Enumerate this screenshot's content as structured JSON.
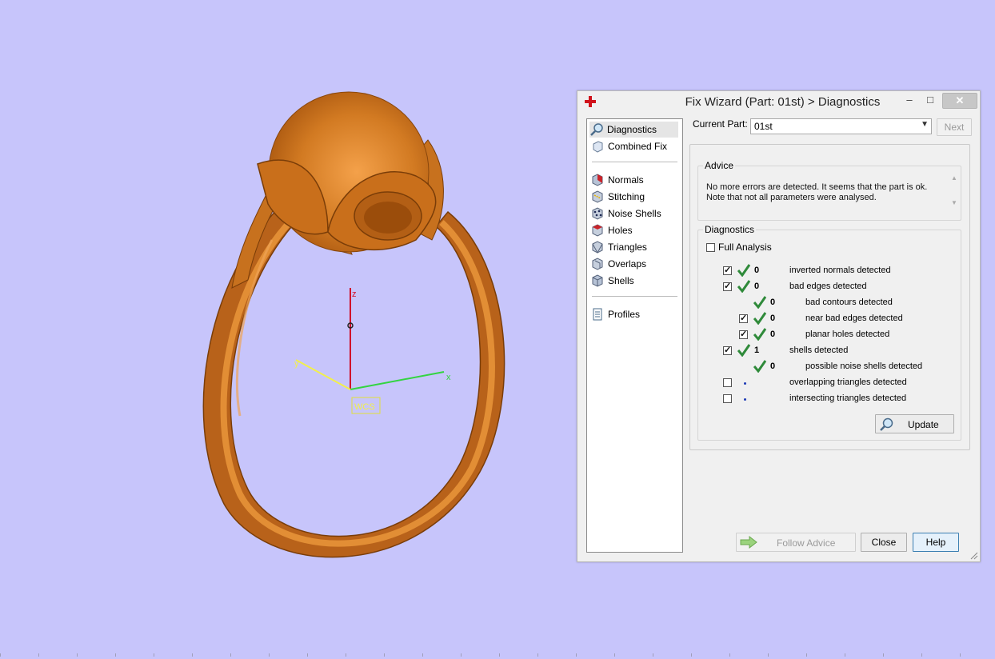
{
  "scene": {
    "axes": {
      "z_label": "z",
      "y_label": "y",
      "x_label": "x",
      "wcs_label": "WCS"
    },
    "colors": {
      "background": "#c7c5fb",
      "ring": "#c7711e",
      "z_axis": "#d0102a",
      "y_axis": "#f2f04a",
      "x_axis": "#33d441"
    }
  },
  "dialog": {
    "title": "Fix Wizard (Part: 01st) > Diagnostics",
    "window_buttons": {
      "minimize": "–",
      "maximize": "□",
      "close": "✕"
    },
    "nav": {
      "items_top": [
        {
          "label": "Diagnostics",
          "icon": "magnifier-icon",
          "selected": true
        },
        {
          "label": "Combined Fix",
          "icon": "combined-fix-icon",
          "selected": false
        }
      ],
      "items_mid": [
        {
          "label": "Normals",
          "icon": "normals-icon"
        },
        {
          "label": "Stitching",
          "icon": "stitching-icon"
        },
        {
          "label": "Noise Shells",
          "icon": "noise-shells-icon"
        },
        {
          "label": "Holes",
          "icon": "holes-icon"
        },
        {
          "label": "Triangles",
          "icon": "triangles-icon"
        },
        {
          "label": "Overlaps",
          "icon": "overlaps-icon"
        },
        {
          "label": "Shells",
          "icon": "shells-icon"
        }
      ],
      "items_bottom": [
        {
          "label": "Profiles",
          "icon": "profiles-icon"
        }
      ]
    },
    "current_part_label": "Current Part:",
    "current_part_value": "01st",
    "next_label": "Next",
    "advice": {
      "legend": "Advice",
      "line1": "No more errors are detected. It seems that the part is ok.",
      "line2": "Note that not all parameters were analysed."
    },
    "diagnostics": {
      "legend": "Diagnostics",
      "full_analysis_label": "Full Analysis",
      "full_analysis_checked": false,
      "rows": [
        {
          "checkbox": true,
          "checked": true,
          "status": "ok",
          "count": "0",
          "text": "inverted normals detected",
          "indent": 0
        },
        {
          "checkbox": true,
          "checked": true,
          "status": "ok",
          "count": "0",
          "text": "bad edges detected",
          "indent": 0
        },
        {
          "checkbox": false,
          "checked": false,
          "status": "ok",
          "count": "0",
          "text": "bad contours detected",
          "indent": 1
        },
        {
          "checkbox": true,
          "checked": true,
          "status": "ok",
          "count": "0",
          "text": "near bad edges detected",
          "indent": 1
        },
        {
          "checkbox": true,
          "checked": true,
          "status": "ok",
          "count": "0",
          "text": "planar holes detected",
          "indent": 1
        },
        {
          "checkbox": true,
          "checked": true,
          "status": "ok",
          "count": "1",
          "text": "shells detected",
          "indent": 0
        },
        {
          "checkbox": false,
          "checked": false,
          "status": "ok",
          "count": "0",
          "text": "possible noise shells detected",
          "indent": 1
        },
        {
          "checkbox": true,
          "checked": false,
          "status": "pending",
          "count": "",
          "text": "overlapping triangles detected",
          "indent": 0
        },
        {
          "checkbox": true,
          "checked": false,
          "status": "pending",
          "count": "",
          "text": "intersecting triangles detected",
          "indent": 0
        }
      ],
      "update_label": "Update"
    },
    "buttons": {
      "follow_advice": "Follow Advice",
      "close": "Close",
      "help": "Help"
    }
  }
}
